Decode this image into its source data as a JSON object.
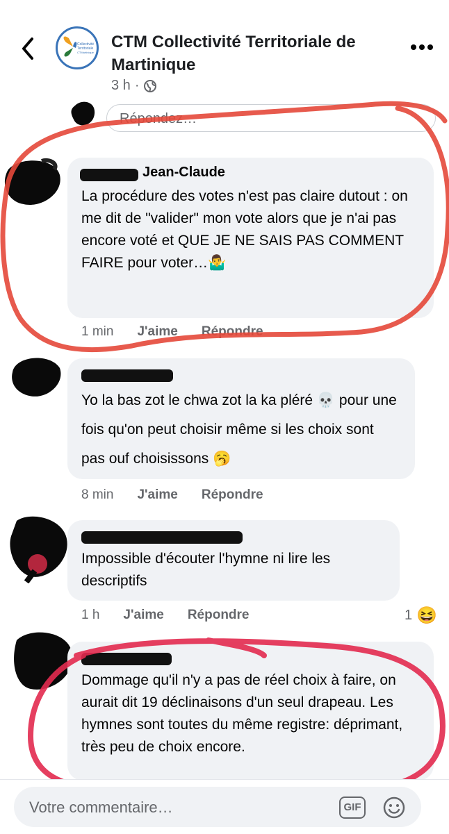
{
  "header": {
    "page_name": "CTM Collectivité Territoriale de Martinique",
    "time": "3 h",
    "logo_text": "Collectivité Territoriale CTMartinique"
  },
  "reply_placeholder": "Répondez…",
  "comments": [
    {
      "author": "Jean-Claude",
      "text": "La procédure des votes n'est pas claire dutout : on me dit de \"valider\" mon vote alors que je n'ai pas encore voté et QUE JE NE SAIS PAS COMMENT FAIRE pour voter…🤷‍♂️",
      "time": "1 min",
      "like": "J'aime",
      "reply": "Répondre"
    },
    {
      "author": "",
      "text": "Yo la bas zot le chwa zot la ka pléré 💀 pour une fois qu'on peut choisir même si les choix sont pas ouf choisissons 🥱",
      "time": "8 min",
      "like": "J'aime",
      "reply": "Répondre"
    },
    {
      "author": "",
      "text": "Impossible d'écouter l'hymne ni lire les descriptifs",
      "time": "1 h",
      "like": "J'aime",
      "reply": "Répondre",
      "reaction_count": "1",
      "reaction_emoji": "😆"
    },
    {
      "author": "",
      "text": "Dommage qu'il n'y a pas de réel choix à faire, on aurait dit 19 déclinaisons d'un seul drapeau. Les hymnes sont toutes du même registre: déprimant, très peu de choix encore."
    }
  ],
  "composer": {
    "placeholder": "Votre commentaire…",
    "gif_label": "GIF"
  },
  "colors": {
    "annotation_red": "#e4483a",
    "annotation_pink": "#e22a4f",
    "bubble_bg": "#f0f2f5",
    "meta_text": "#65676b"
  }
}
